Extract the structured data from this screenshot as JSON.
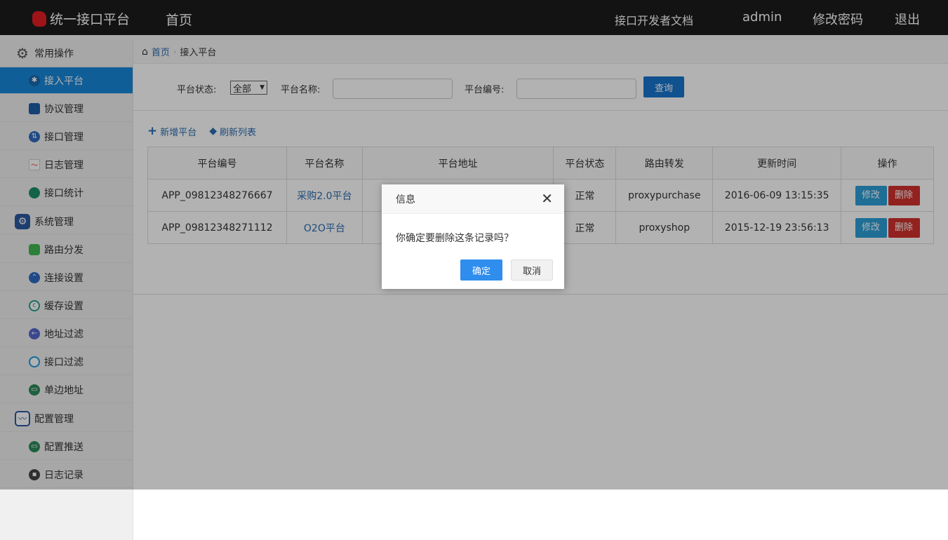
{
  "header": {
    "app_title": "统一接口平台",
    "home": "首页",
    "docs": "接口开发者文档",
    "user": "admin",
    "change_password": "修改密码",
    "logout": "退出"
  },
  "sidebar": {
    "groups": [
      {
        "label": "常用操作",
        "icon": "gear-icon"
      },
      {
        "label": "系统管理",
        "icon": "settings-icon"
      },
      {
        "label": "配置管理",
        "icon": "monitor-icon"
      }
    ],
    "items": [
      {
        "label": "接入平台",
        "icon": "user-access-icon",
        "active": true
      },
      {
        "label": "协议管理",
        "icon": "document-icon"
      },
      {
        "label": "接口管理",
        "icon": "swap-icon"
      },
      {
        "label": "日志管理",
        "icon": "chart-icon"
      },
      {
        "label": "接口统计",
        "icon": "pie-icon"
      },
      {
        "label": "路由分发",
        "icon": "route-icon"
      },
      {
        "label": "连接设置",
        "icon": "link-icon"
      },
      {
        "label": "缓存设置",
        "icon": "cache-icon"
      },
      {
        "label": "地址过滤",
        "icon": "filter-icon"
      },
      {
        "label": "接口过滤",
        "icon": "ring-icon"
      },
      {
        "label": "单边地址",
        "icon": "screen-icon"
      },
      {
        "label": "配置推送",
        "icon": "push-icon"
      },
      {
        "label": "日志记录",
        "icon": "record-icon"
      }
    ]
  },
  "breadcrumb": {
    "home": "首页",
    "current": "接入平台"
  },
  "search": {
    "status_label": "平台状态:",
    "status_value": "全部",
    "name_label": "平台名称:",
    "name_value": "",
    "code_label": "平台编号:",
    "code_value": "",
    "query_button": "查询"
  },
  "toolbar": {
    "add": "新增平台",
    "refresh": "刷新列表"
  },
  "table": {
    "headers": [
      "平台编号",
      "平台名称",
      "平台地址",
      "平台状态",
      "路由转发",
      "更新时间",
      "操作"
    ],
    "rows": [
      {
        "code": "APP_09812348276667",
        "name": "采购2.0平台",
        "address": "",
        "status": "正常",
        "route": "proxypurchase",
        "updated": "2016-06-09 13:15:35",
        "edit": "修改",
        "delete": "删除"
      },
      {
        "code": "APP_09812348271112",
        "name": "O2O平台",
        "address": "",
        "status": "正常",
        "route": "proxyshop",
        "updated": "2015-12-19 23:56:13",
        "edit": "修改",
        "delete": "删除"
      }
    ]
  },
  "dialog": {
    "title": "信息",
    "message": "你确定要删除这条记录吗？",
    "ok": "确定",
    "cancel": "取消"
  },
  "colors": {
    "topbar": "#1c1c1c",
    "active_nav": "#1787d8",
    "primary": "#1874cd",
    "edit": "#2c9ed6",
    "delete": "#d2322d",
    "dialog_ok": "#2e8ded"
  }
}
